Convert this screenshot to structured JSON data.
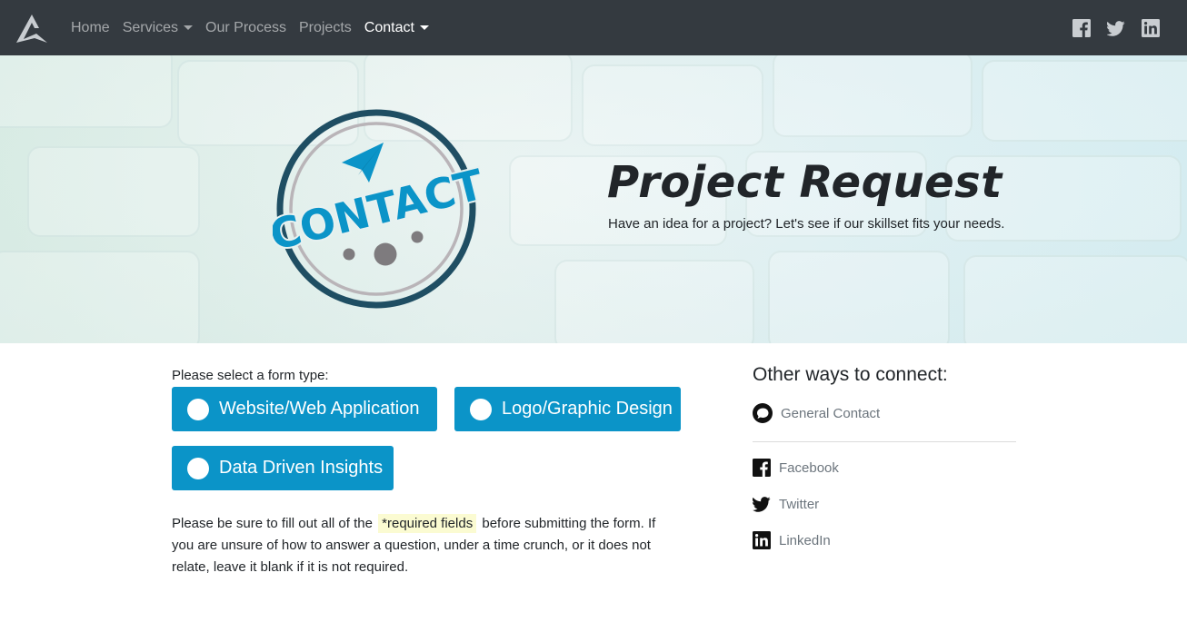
{
  "nav": {
    "brand": "brand-logo",
    "links": [
      {
        "label": "Home",
        "dropdown": false,
        "active": false
      },
      {
        "label": "Services",
        "dropdown": true,
        "active": false
      },
      {
        "label": "Our Process",
        "dropdown": false,
        "active": false
      },
      {
        "label": "Projects",
        "dropdown": false,
        "active": false
      },
      {
        "label": "Contact",
        "dropdown": true,
        "active": true
      }
    ],
    "social_icons": [
      "facebook-icon",
      "twitter-icon",
      "linkedin-icon"
    ]
  },
  "hero": {
    "logo_text": "CONTACT",
    "title": "Project Request",
    "subtitle": "Have an idea for a project? Let's see if our skillset fits your needs."
  },
  "form": {
    "label": "Please select a form type:",
    "types": [
      "Website/Web Application",
      "Logo/Graphic Design",
      "Data Driven Insights"
    ],
    "note_before": "Please be sure to fill out all of the",
    "note_highlight": "*required fields",
    "note_after": "before submitting the form. If you are unsure of how to answer a question, under a time crunch, or it does not relate, leave it blank if it is not required."
  },
  "sidebar": {
    "title": "Other ways to connect:",
    "general": "General Contact",
    "links": [
      "Facebook",
      "Twitter",
      "LinkedIn"
    ]
  },
  "colors": {
    "navbar": "#343a40",
    "button": "#0b94c8",
    "logo_dark": "#1f4e63",
    "logo_blue": "#0b94c8",
    "highlight": "#fbfbd2"
  }
}
